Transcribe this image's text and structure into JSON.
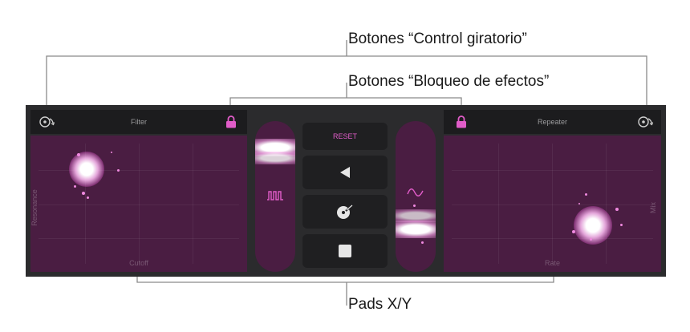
{
  "callouts": {
    "rotate_buttons": "Botones “Control giratorio”",
    "lock_buttons": "Botones “Bloqueo de efectos”",
    "xy_pads": "Pads X/Y"
  },
  "left_effect": {
    "title": "Filter",
    "x_axis": "Cutoff",
    "y_axis": "Resonance"
  },
  "right_effect": {
    "title": "Repeater",
    "x_axis": "Rate",
    "y_axis": "Mix"
  },
  "controls": {
    "reset_label": "RESET"
  },
  "colors": {
    "accent": "#e05cc8",
    "pad": "#4a1d42",
    "panel": "#2b2b2d"
  },
  "icons": [
    "rotate-control-icon",
    "lock-icon",
    "square-wave-icon",
    "sine-wave-icon",
    "play-reverse-icon",
    "scratch-icon",
    "stop-icon"
  ]
}
